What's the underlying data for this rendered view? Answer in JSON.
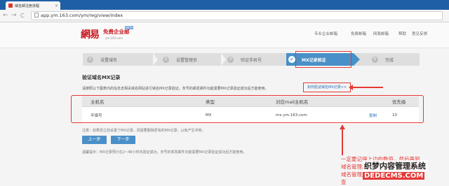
{
  "browser": {
    "tab_title": "域名邮注册流程",
    "tab_close": "×",
    "back": "←",
    "forward": "→",
    "reload": "C",
    "url": "app.ym.163.com/ym/reg/view/index"
  },
  "header": {
    "logo_cn": "網易",
    "logo_product": "免费企业邮",
    "logo_beta": "BETA",
    "logo_url": "ym.163.com",
    "nav": [
      "专业企业邮箱",
      "免费邮箱",
      "网易邮箱",
      "帮助",
      "意见反馈"
    ]
  },
  "steps": [
    {
      "num": "1",
      "label": "设置域名"
    },
    {
      "num": "2",
      "label": "设置管理员"
    },
    {
      "num": "3",
      "label": "验证手机号"
    },
    {
      "num": "✔",
      "label": "MX记录验证"
    },
    {
      "num": "5",
      "label": "完成"
    }
  ],
  "section": {
    "title": "验证域名MX记录",
    "instruction": "请按照以下图表内的信息去相关域名网站进行域名MX记录验证，务号的邮发邮件功能需要MX记录验证成功后方能使用。",
    "howto_link": "如何验证域名MX记录>>"
  },
  "table": {
    "headers": [
      "主机名",
      "类型",
      "对应mail主机名",
      "优先级"
    ],
    "row": {
      "host": "不填写",
      "type": "MX",
      "mail_host": "mx.ym.163.com",
      "copy": "复制",
      "priority": "10"
    }
  },
  "note": "注意：如果您之前设置了MX记录，则需要删除原有的MX记录，以免产生冲突。",
  "buttons": {
    "prev": "上一步",
    "next": "下一步"
  },
  "tip": "温馨提示：MX记录预计在2~48小时内验证成功，务号的收发邮件功能需要MX记录验证成功后方能使用。",
  "annotation": [
    "一定要记得上边的数值，然后再到",
    "域名管理后台进行设置，域名管理",
    "域名管理后台进行设置。也可点击",
    "查"
  ],
  "watermark": {
    "line1": "织梦内容管理系统",
    "line2": "DEDECMS.COM"
  },
  "colors": {
    "accent": "#4a90c8",
    "highlight": "#e53935",
    "brand": "#c8161d"
  }
}
